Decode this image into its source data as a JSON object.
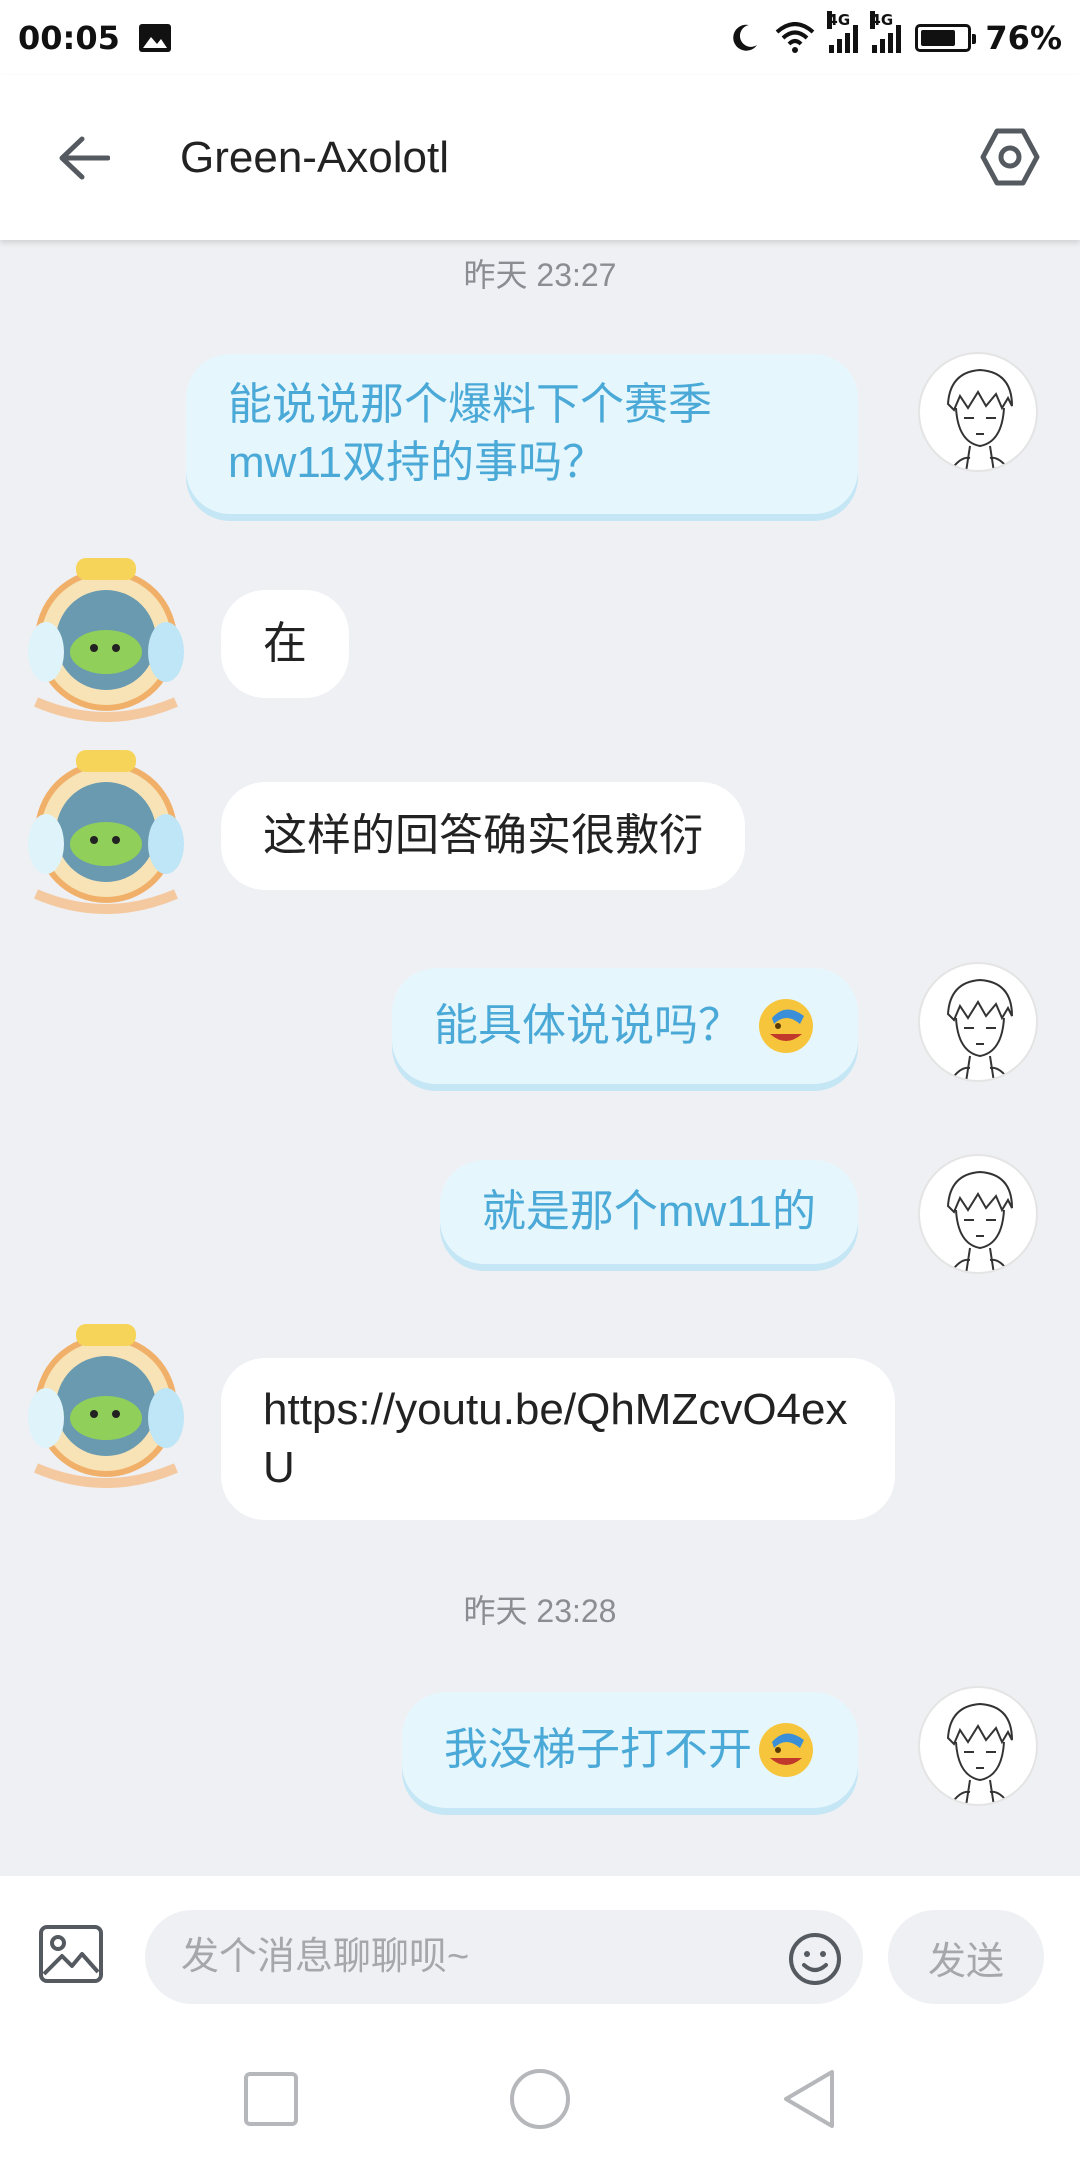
{
  "status_bar": {
    "time": "00:05",
    "network_1": "4G",
    "network_2": "4G",
    "battery_level": 0.76,
    "battery_text": "76%"
  },
  "header": {
    "title": "Green-Axolotl",
    "back_icon": "arrow-left-icon",
    "settings_icon": "hexagon-settings-icon"
  },
  "messages": [
    {
      "type": "timestamp",
      "text": "昨天 23:27"
    },
    {
      "type": "self",
      "text": "能说说那个爆料下个赛季mw11双持的事吗？"
    },
    {
      "type": "other",
      "text": "在"
    },
    {
      "type": "other",
      "text": "这样的回答确实很敷衍"
    },
    {
      "type": "self",
      "text": "能具体说说吗？",
      "emoji": "facepalm-emoji"
    },
    {
      "type": "self",
      "text": "就是那个mw11的"
    },
    {
      "type": "other",
      "text": "https://youtu.be/QhMZcvO4exU"
    },
    {
      "type": "timestamp",
      "text": "昨天 23:28"
    },
    {
      "type": "self",
      "text": "我没梯子打不开",
      "emoji": "facepalm-emoji"
    }
  ],
  "composer": {
    "placeholder": "发个消息聊聊呗~",
    "send_label": "发送"
  },
  "colors": {
    "self_bubble_bg": "#e6f6fd",
    "self_bubble_text": "#4aa9d7",
    "other_bubble_bg": "#ffffff",
    "chat_bg": "#eff0f3"
  }
}
